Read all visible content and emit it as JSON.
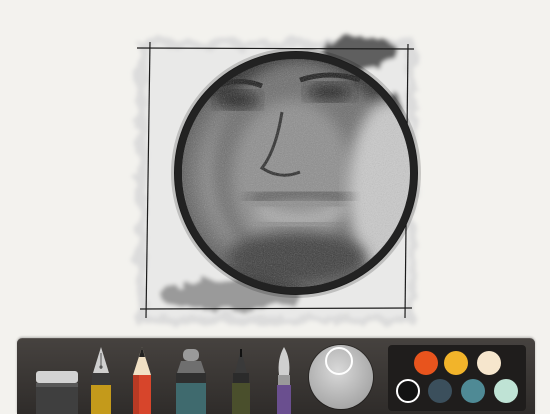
{
  "app": {
    "toolbar": {
      "tools": [
        {
          "id": "eraser",
          "icon": "eraser-icon"
        },
        {
          "id": "fountain-pen",
          "icon": "fountain-pen-icon"
        },
        {
          "id": "pencil",
          "icon": "pencil-icon"
        },
        {
          "id": "marker",
          "icon": "marker-icon"
        },
        {
          "id": "fineliner",
          "icon": "fineliner-icon"
        },
        {
          "id": "brush",
          "icon": "brush-icon"
        }
      ],
      "mixer": {
        "icon": "color-mixer-icon"
      }
    },
    "palette": {
      "swatches": [
        {
          "color": "#e8541d"
        },
        {
          "color": "#f2b42a"
        },
        {
          "color": "#f6e6cd"
        },
        {
          "color": "#121212",
          "selected": true
        },
        {
          "color": "#3b4f5c"
        },
        {
          "color": "#4f8a95"
        },
        {
          "color": "#bfe3d5"
        }
      ]
    }
  }
}
